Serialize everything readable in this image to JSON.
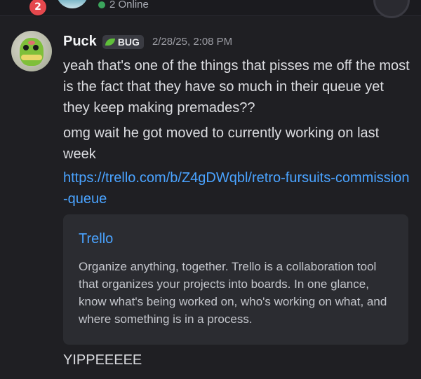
{
  "topbar": {
    "notification_count": "2",
    "online_status": "2 Online"
  },
  "message": {
    "username": "Puck",
    "role_tag": "BUG",
    "timestamp": "2/28/25, 2:08 PM",
    "lines": [
      "yeah that's one of the things that pisses me off the most is the fact that they have so much in their queue yet they keep making premades??",
      "omg wait he got moved to currently working on last week",
      "https://trello.com/b/Z4gDWqbl/retro-fursuits-commission-queue",
      "YIPPEEEEE"
    ],
    "embed": {
      "title": "Trello",
      "description": "Organize anything, together. Trello is a collaboration tool that organizes your projects into boards. In one glance, know what's being worked on, who's working on what, and where something is in a process."
    },
    "colors": {
      "link": "#4aa3ff",
      "online": "#3ba55c",
      "badge": "#e5484d"
    },
    "icons": {
      "tag_icon": "leaf-icon",
      "status_icon": "online-dot-icon"
    }
  }
}
